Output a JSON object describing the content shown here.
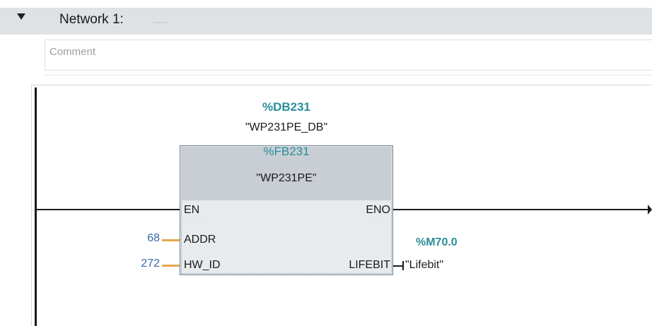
{
  "network": {
    "title": "Network 1:",
    "title_extra": "......",
    "comment_placeholder": "Comment"
  },
  "block": {
    "instance_db_address": "%DB231",
    "instance_db_name": "\"WP231PE_DB\"",
    "fb_address": "%FB231",
    "fb_name": "\"WP231PE\"",
    "inputs": [
      {
        "pin": "EN",
        "value": ""
      },
      {
        "pin": "ADDR",
        "value": "68"
      },
      {
        "pin": "HW_ID",
        "value": "272"
      }
    ],
    "outputs": [
      {
        "pin": "ENO"
      },
      {
        "pin": "LIFEBIT",
        "address": "%M70.0",
        "name": "\"Lifebit\""
      }
    ]
  },
  "colors": {
    "address_teal": "#2a8e9a",
    "constant_blue": "#3a66a8",
    "input_wire": "#e1a84a",
    "block_fill": "#e8ebee",
    "block_header": "#c9ced4"
  }
}
